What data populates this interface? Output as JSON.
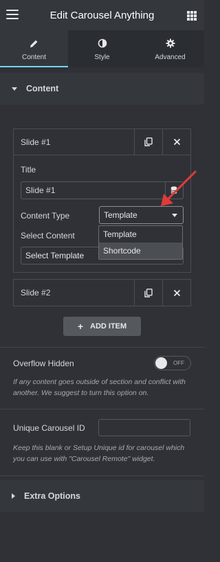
{
  "header": {
    "title": "Edit Carousel Anything"
  },
  "tabs": [
    {
      "label": "Content",
      "icon": "pencil-icon",
      "active": true
    },
    {
      "label": "Style",
      "icon": "half-circle-icon",
      "active": false
    },
    {
      "label": "Advanced",
      "icon": "gear-icon",
      "active": false
    }
  ],
  "content_section": {
    "title": "Content",
    "slides": [
      {
        "title": "Slide #1",
        "fields": {
          "title_label": "Title",
          "title_value": "Slide #1",
          "content_type_label": "Content Type",
          "content_type_value": "Template",
          "select_content_label": "Select Content",
          "select_template_value": "Select Template"
        }
      },
      {
        "title": "Slide #2"
      }
    ],
    "dropdown_options": [
      "Template",
      "Shortcode"
    ],
    "add_item_label": "ADD ITEM"
  },
  "overflow": {
    "label": "Overflow Hidden",
    "toggle_state": "OFF",
    "help": "If any content goes outside of section and conflict with another. We suggest to turn this option on."
  },
  "carousel_id": {
    "label": "Unique Carousel ID",
    "value": "",
    "help": "Keep this blank or Setup Unique id for carousel which you can use with \"Carousel Remote\" widget."
  },
  "extra_options": {
    "title": "Extra Options"
  },
  "colors": {
    "accent": "#71d7f7",
    "annotation_arrow": "#e03a3a",
    "panel_bg": "#2f3136",
    "header_bg": "#34383c"
  }
}
